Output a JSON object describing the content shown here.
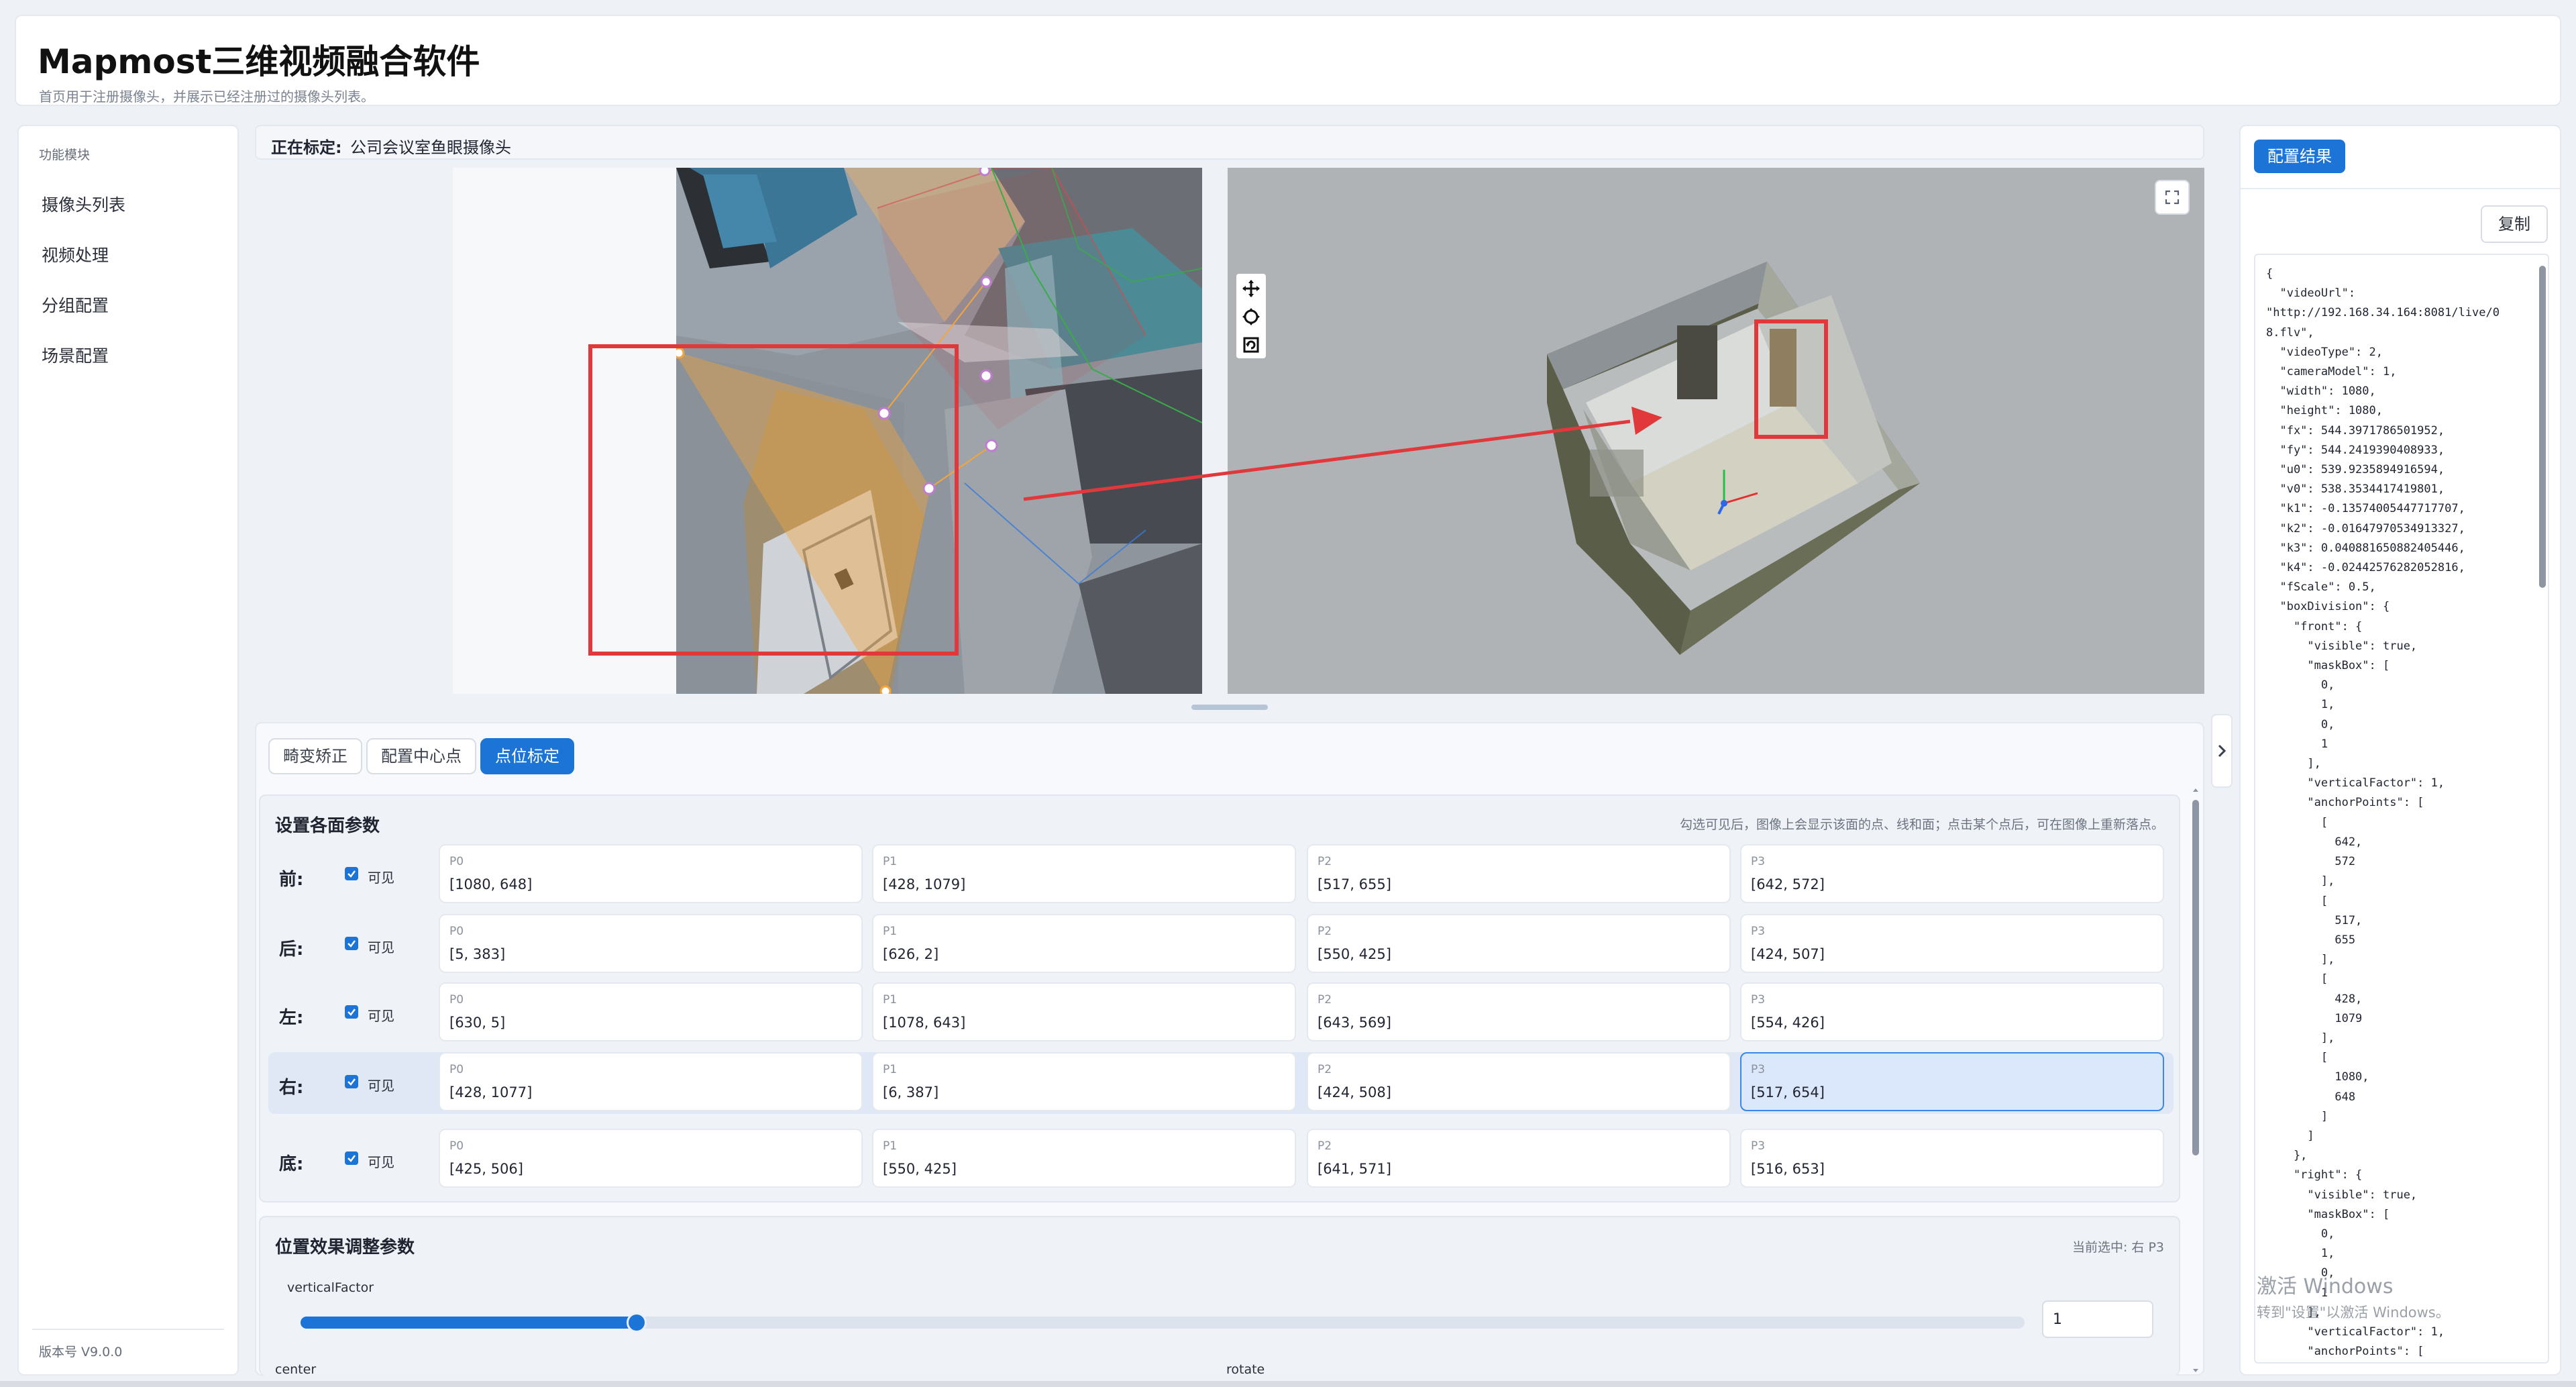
{
  "header": {
    "title": "Mapmost三维视频融合软件",
    "subtitle": "首页用于注册摄像头，并展示已经注册过的摄像头列表。"
  },
  "sidebar": {
    "heading": "功能模块",
    "items": [
      {
        "label": "摄像头列表"
      },
      {
        "label": "视频处理"
      },
      {
        "label": "分组配置"
      },
      {
        "label": "场景配置"
      }
    ],
    "version": "版本号 V9.0.0"
  },
  "calibration": {
    "label": "正在标定:",
    "camera_name": "公司会议室鱼眼摄像头"
  },
  "tabs": [
    {
      "label": "畸变矫正",
      "active": false
    },
    {
      "label": "配置中心点",
      "active": false
    },
    {
      "label": "点位标定",
      "active": true
    }
  ],
  "faces_panel": {
    "title": "设置各面参数",
    "hint": "勾选可见后，图像上会显示该面的点、线和面；点击某个点后，可在图像上重新落点。",
    "visible_label": "可见",
    "rows": [
      {
        "name": "前:",
        "visible": true,
        "selected": false,
        "points": [
          {
            "name": "P0",
            "value": "[1080, 648]",
            "selected": false
          },
          {
            "name": "P1",
            "value": "[428, 1079]",
            "selected": false
          },
          {
            "name": "P2",
            "value": "[517, 655]",
            "selected": false
          },
          {
            "name": "P3",
            "value": "[642, 572]",
            "selected": false
          }
        ]
      },
      {
        "name": "后:",
        "visible": true,
        "selected": false,
        "points": [
          {
            "name": "P0",
            "value": "[5, 383]",
            "selected": false
          },
          {
            "name": "P1",
            "value": "[626, 2]",
            "selected": false
          },
          {
            "name": "P2",
            "value": "[550, 425]",
            "selected": false
          },
          {
            "name": "P3",
            "value": "[424, 507]",
            "selected": false
          }
        ]
      },
      {
        "name": "左:",
        "visible": true,
        "selected": false,
        "points": [
          {
            "name": "P0",
            "value": "[630, 5]",
            "selected": false
          },
          {
            "name": "P1",
            "value": "[1078, 643]",
            "selected": false
          },
          {
            "name": "P2",
            "value": "[643, 569]",
            "selected": false
          },
          {
            "name": "P3",
            "value": "[554, 426]",
            "selected": false
          }
        ]
      },
      {
        "name": "右:",
        "visible": true,
        "selected": true,
        "points": [
          {
            "name": "P0",
            "value": "[428, 1077]",
            "selected": false
          },
          {
            "name": "P1",
            "value": "[6, 387]",
            "selected": false
          },
          {
            "name": "P2",
            "value": "[424, 508]",
            "selected": false
          },
          {
            "name": "P3",
            "value": "[517, 654]",
            "selected": true
          }
        ]
      },
      {
        "name": "底:",
        "visible": true,
        "selected": false,
        "points": [
          {
            "name": "P0",
            "value": "[425, 506]",
            "selected": false
          },
          {
            "name": "P1",
            "value": "[550, 425]",
            "selected": false
          },
          {
            "name": "P2",
            "value": "[641, 571]",
            "selected": false
          },
          {
            "name": "P3",
            "value": "[516, 653]",
            "selected": false
          }
        ]
      }
    ]
  },
  "position_panel": {
    "title": "位置效果调整参数",
    "current": "当前选中: 右 P3",
    "vertical_factor_label": "verticalFactor",
    "vertical_factor_value": "1",
    "vertical_factor_fraction": 0.195,
    "center_label": "center",
    "rotate_label": "rotate"
  },
  "result_panel": {
    "tab_label": "配置结果",
    "copy_label": "复制",
    "json_text": "{\n  \"videoUrl\":\n\"http://192.168.34.164:8081/live/0\n8.flv\",\n  \"videoType\": 2,\n  \"cameraModel\": 1,\n  \"width\": 1080,\n  \"height\": 1080,\n  \"fx\": 544.3971786501952,\n  \"fy\": 544.2419390408933,\n  \"u0\": 539.9235894916594,\n  \"v0\": 538.3534417419801,\n  \"k1\": -0.13574005447717707,\n  \"k2\": -0.01647970534913327,\n  \"k3\": 0.040881650882405446,\n  \"k4\": -0.02442576282052816,\n  \"fScale\": 0.5,\n  \"boxDivision\": {\n    \"front\": {\n      \"visible\": true,\n      \"maskBox\": [\n        0,\n        1,\n        0,\n        1\n      ],\n      \"verticalFactor\": 1,\n      \"anchorPoints\": [\n        [\n          642,\n          572\n        ],\n        [\n          517,\n          655\n        ],\n        [\n          428,\n          1079\n        ],\n        [\n          1080,\n          648\n        ]\n      ]\n    },\n    \"right\": {\n      \"visible\": true,\n      \"maskBox\": [\n        0,\n        1,\n        0,\n        1\n      ],\n      \"verticalFactor\": 1,\n      \"anchorPoints\": ["
  },
  "os_watermark": {
    "line1": "激活 Windows",
    "line2": "转到\"设置\"以激活 Windows。"
  },
  "colors": {
    "accent": "#1b74d6",
    "highlight_red": "#e0383b"
  }
}
